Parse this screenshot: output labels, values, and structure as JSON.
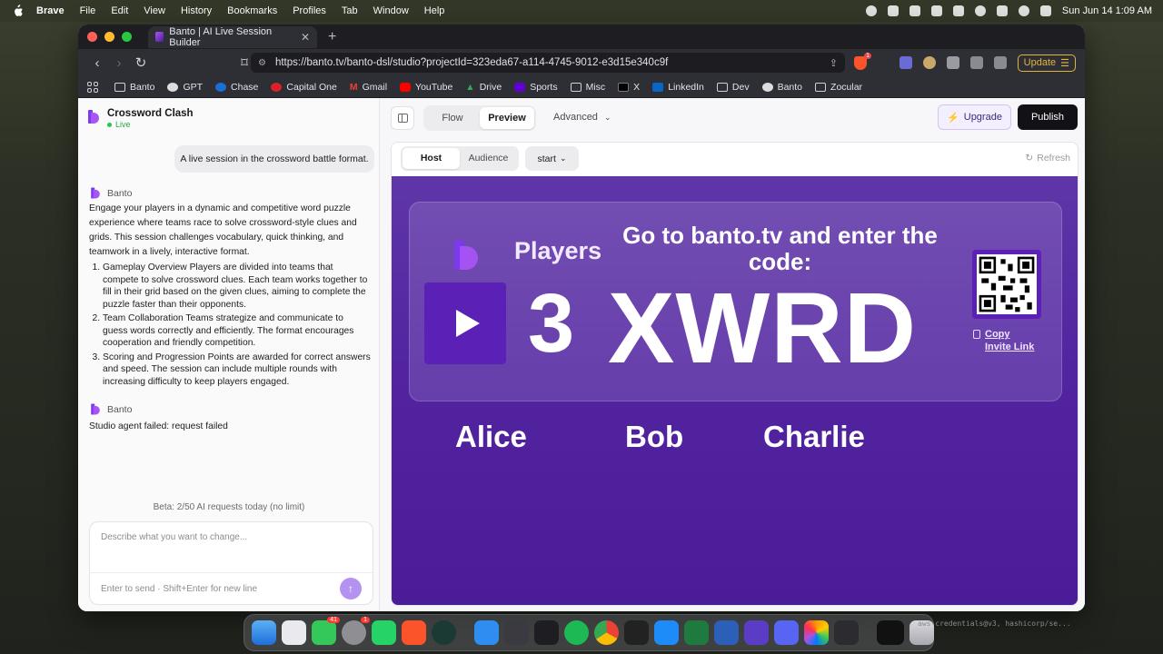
{
  "menubar": {
    "items": [
      "Brave",
      "File",
      "Edit",
      "View",
      "History",
      "Bookmarks",
      "Profiles",
      "Tab",
      "Window",
      "Help"
    ],
    "datetime": "Sun Jun 14  1:09 AM"
  },
  "browser": {
    "tab_title": "Banto | AI Live Session Builder",
    "url": "https://banto.tv/banto-dsl/studio?projectId=323eda67-a114-4745-9012-e3d15e340c9f",
    "shield_badge": "1",
    "update_label": "Update",
    "bookmarks": [
      "Banto",
      "GPT",
      "Chase",
      "Capital One",
      "Gmail",
      "YouTube",
      "Drive",
      "Sports",
      "Misc",
      "X",
      "LinkedIn",
      "Dev",
      "Banto",
      "Zocular"
    ]
  },
  "project": {
    "title": "Crossword Clash",
    "status": "Live"
  },
  "chat": {
    "user_message": "A live session in the crossword battle format.",
    "agent_name": "Banto",
    "agent_intro": "Engage your players in a dynamic and competitive word puzzle experience where teams race to solve crossword-style clues and grids. This session challenges vocabulary, quick thinking, and teamwork in a lively, interactive format.",
    "agent_list": [
      "Gameplay Overview Players are divided into teams that compete to solve crossword clues. Each team works together to fill in their grid based on the given clues, aiming to complete the puzzle faster than their opponents.",
      "Team Collaboration Teams strategize and communicate to guess words correctly and efficiently. The format encourages cooperation and friendly competition.",
      "Scoring and Progression Points are awarded for correct answers and speed. The session can include multiple rounds with increasing difficulty to keep players engaged."
    ],
    "agent_error": "Studio agent failed: request failed",
    "beta_note": "Beta: 2/50 AI requests today (no limit)",
    "input_placeholder": "Describe what you want to change...",
    "input_hint": "Enter to send · Shift+Enter for new line"
  },
  "toolbar": {
    "tabs": [
      "Flow",
      "Preview"
    ],
    "active_tab": "Preview",
    "advanced_label": "Advanced",
    "upgrade_label": "Upgrade",
    "publish_label": "Publish"
  },
  "preview": {
    "roles": [
      "Host",
      "Audience"
    ],
    "active_role": "Host",
    "state_value": "start",
    "refresh_label": "Refresh",
    "players_label": "Players",
    "players_count": "3",
    "join_text": "Go to banto.tv and enter the code:",
    "join_code": "XWRD",
    "copy_link_label": "Copy Invite Link",
    "player_names": [
      "Alice",
      "Bob",
      "Charlie"
    ]
  },
  "dock": {
    "messages_badge": "41",
    "settings_badge": "1",
    "terminal_text": "aws-credentials@v3, hashicorp/se..."
  }
}
